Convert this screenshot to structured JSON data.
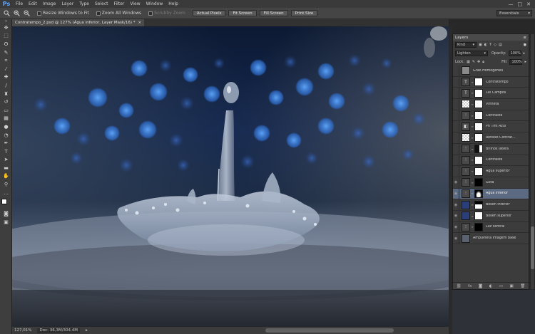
{
  "app": {
    "logo": "Ps",
    "menu": [
      "File",
      "Edit",
      "Image",
      "Layer",
      "Type",
      "Select",
      "Filter",
      "View",
      "Window",
      "Help"
    ],
    "window_controls": [
      "—",
      "□",
      "✕"
    ]
  },
  "options_bar": {
    "tool_icon": "zoom-tool-icon",
    "checkboxes": [
      {
        "label": "Resize Windows to Fit",
        "checked": false,
        "enabled": true
      },
      {
        "label": "Zoom All Windows",
        "checked": false,
        "enabled": true
      },
      {
        "label": "Scrubby Zoom",
        "checked": false,
        "enabled": false
      }
    ],
    "buttons": [
      "Actual Pixels",
      "Fit Screen",
      "Fill Screen",
      "Print Size"
    ],
    "workspace": "Essentials"
  },
  "document": {
    "tab_title": "Contratempo_2.psd @ 127% (Água inferior, Layer Mask/16) *",
    "close": "×"
  },
  "status": {
    "zoom": "127,01%",
    "doc_info": "Doc: 36,3M/304,4M"
  },
  "layers_panel": {
    "title": "Layers",
    "filter_kind": "Kind",
    "blend_mode": "Lighten",
    "opacity_label": "Opacity:",
    "opacity_value": "100%",
    "lock_label": "Lock:",
    "fill_label": "Fill:",
    "fill_value": "100%",
    "layers": [
      {
        "name": "Grao Homogeneo",
        "visible": false,
        "thumb": "gray",
        "mask": null,
        "selected": false
      },
      {
        "name": "Contratempo",
        "visible": false,
        "thumb": "type",
        "mask": "white",
        "selected": false
      },
      {
        "name": "1ei Campos",
        "visible": false,
        "thumb": "type",
        "mask": "white",
        "selected": false
      },
      {
        "name": "Vinheta",
        "visible": false,
        "thumb": "checker",
        "mask": "white",
        "selected": false
      },
      {
        "name": "Contraste",
        "visible": false,
        "thumb": "levels",
        "mask": "white",
        "selected": false
      },
      {
        "name": "Ph Tint Azul",
        "visible": false,
        "thumb": "adjust",
        "mask": "white",
        "selected": false
      },
      {
        "name": "Reflexo Contrat...",
        "visible": false,
        "thumb": "checker",
        "mask": "white",
        "selected": false
      },
      {
        "name": "Brilhos latera",
        "visible": false,
        "thumb": "levels",
        "mask": "dark",
        "selected": false
      },
      {
        "name": "Contraste",
        "visible": false,
        "thumb": "levels",
        "mask": "white",
        "selected": false
      },
      {
        "name": "Água superior",
        "visible": false,
        "thumb": "levels",
        "mask": "white",
        "selected": false
      },
      {
        "name": "Gota",
        "visible": true,
        "thumb": "levels",
        "mask": "black",
        "selected": false
      },
      {
        "name": "Água inferior",
        "visible": true,
        "thumb": "levels",
        "mask": "water",
        "selected": true
      },
      {
        "name": "Bokeh inferior",
        "visible": true,
        "thumb": "blue",
        "mask": "mixed",
        "selected": false
      },
      {
        "name": "Bokeh superior",
        "visible": true,
        "thumb": "blue",
        "mask": "white",
        "selected": false
      },
      {
        "name": "Luz central",
        "visible": true,
        "thumb": "levels",
        "mask": "black",
        "selected": false
      },
      {
        "name": "Ampulheta Imagem base",
        "visible": true,
        "thumb": "photo",
        "mask": null,
        "selected": false
      }
    ],
    "footer_icons": [
      "link-icon",
      "fx-icon",
      "mask-icon",
      "adjustment-icon",
      "folder-icon",
      "new-layer-icon",
      "trash-icon"
    ]
  },
  "colors": {
    "chrome_dark": "#282828",
    "panel": "#3c3c3c",
    "selected_layer": "#5b6a80",
    "accent": "#5fa8ff"
  }
}
